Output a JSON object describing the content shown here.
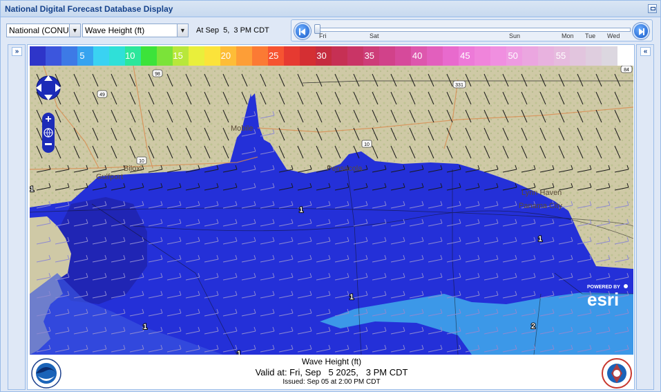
{
  "window": {
    "title": "National Digital Forecast Database Display"
  },
  "toolbar": {
    "region_value": "National (CONUS)",
    "element_value": "Wave Height (ft)",
    "valid_time_label": "At Sep  5,  3 PM CDT"
  },
  "timeline": {
    "days": [
      "Fri",
      "Sat",
      "Sun",
      "Mon",
      "Tue",
      "Wed"
    ],
    "position_fraction": 0.0
  },
  "colorbar": {
    "labels": [
      "5",
      "10",
      "15",
      "20",
      "25",
      "30",
      "35",
      "40",
      "45",
      "50",
      "55"
    ],
    "colors": [
      "#2e35c9",
      "#3c56dd",
      "#3d7ae6",
      "#36a3ef",
      "#3ad2f2",
      "#2fe0d8",
      "#2ce69b",
      "#3ce33a",
      "#7be339",
      "#b8e73b",
      "#e9ef3b",
      "#fbe33a",
      "#fdbd37",
      "#fd9e37",
      "#fb7a34",
      "#f65431",
      "#e63a31",
      "#d42f33",
      "#c52c3f",
      "#c63054",
      "#c93566",
      "#cd3d78",
      "#d1428a",
      "#d64a9b",
      "#dd57ad",
      "#e25fbd",
      "#e86acd",
      "#ed7ad8",
      "#f084db",
      "#f08fe0",
      "#ee9be1",
      "#eba6e0",
      "#e8b2df",
      "#e6bbde",
      "#e2c5de",
      "#dfcedf",
      "#dcd7e0",
      "#ffffff"
    ]
  },
  "map": {
    "city_labels": [
      "Mobile",
      "Gulfport",
      "Biloxi",
      "Pensacola",
      "Lynn Haven",
      "Panama City"
    ],
    "highway_shields": [
      "98",
      "49",
      "10",
      "10",
      "331",
      "84"
    ],
    "wave_height_labels": [
      "1",
      "1",
      "1",
      "1",
      "1",
      "2",
      "1"
    ],
    "colors": {
      "land": "#cfc9a6",
      "deep_wave": "#2430d8",
      "mid_wave": "#3a56e0",
      "high_wave": "#3c98e8",
      "wind_barb": "#1a1a1a"
    }
  },
  "legend": {
    "title": "Wave Height (ft)",
    "valid": "Valid at: Fri, Sep   5 2025,   3 PM CDT",
    "issued": "Issued: Sep 05 at 2:00 PM CDT"
  },
  "logos": {
    "left": "noaa-logo",
    "right": "nws-logo",
    "attribution": "esri"
  },
  "attribution": {
    "powered_by": "POWERED BY",
    "brand": "esri"
  }
}
